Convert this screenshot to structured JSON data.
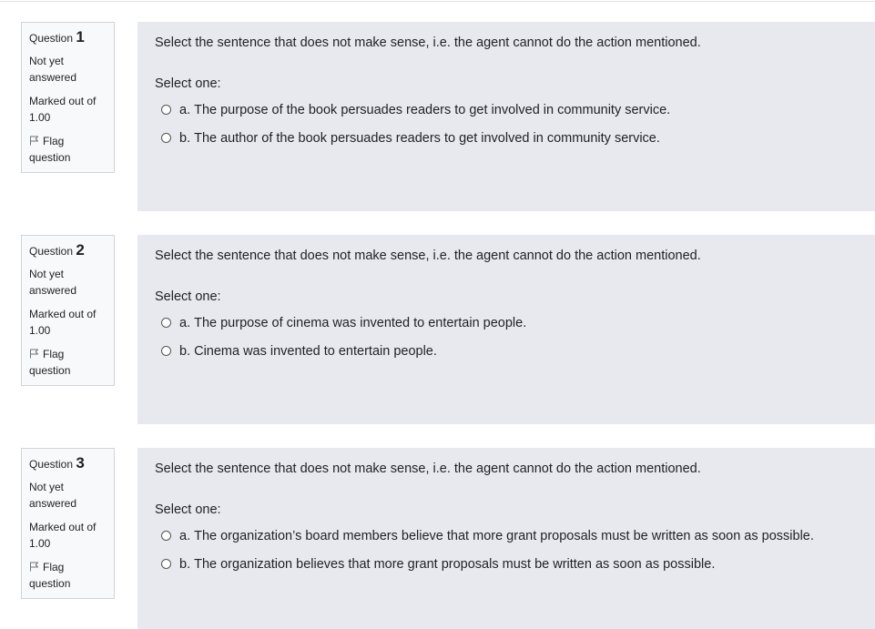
{
  "questions": [
    {
      "label": "Question",
      "number": "1",
      "state": "Not yet answered",
      "grade": "Marked out of 1.00",
      "flag_label": "Flag question",
      "text": "Select the sentence that does not make sense, i.e. the agent cannot do the action mentioned.",
      "prompt": "Select one:",
      "options": [
        {
          "letter": "a.",
          "text": "The purpose of the book persuades readers to get involved in community service."
        },
        {
          "letter": "b.",
          "text": "The author of the book persuades readers to get involved in community service."
        }
      ]
    },
    {
      "label": "Question",
      "number": "2",
      "state": "Not yet answered",
      "grade": "Marked out of 1.00",
      "flag_label": "Flag question",
      "text": "Select the sentence that does not make sense, i.e. the agent cannot do the action mentioned.",
      "prompt": "Select one:",
      "options": [
        {
          "letter": "a.",
          "text": "The purpose of cinema was invented to entertain people."
        },
        {
          "letter": "b.",
          "text": "Cinema was invented to entertain people."
        }
      ]
    },
    {
      "label": "Question",
      "number": "3",
      "state": "Not yet answered",
      "grade": "Marked out of 1.00",
      "flag_label": "Flag question",
      "text": "Select the sentence that does not make sense, i.e. the agent cannot do the action mentioned.",
      "prompt": "Select one:",
      "options": [
        {
          "letter": "a.",
          "text": "The organization’s board members believe that more grant proposals must be written as soon as possible."
        },
        {
          "letter": "b.",
          "text": "The organization believes that more grant proposals must be written as soon as possible."
        }
      ]
    }
  ],
  "icons": {
    "flag": "flag-outline-icon",
    "radio": "radio-unchecked-icon"
  },
  "colors": {
    "info_bg": "#f8f9fa",
    "info_border": "#cfd4d8",
    "content_bg": "#e7e9ef",
    "text": "#1d2125"
  }
}
